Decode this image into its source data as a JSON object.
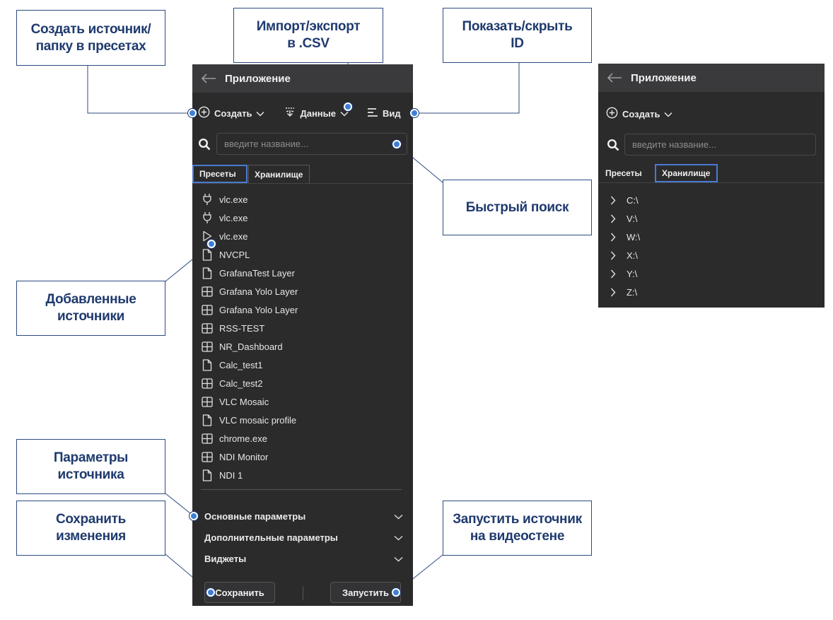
{
  "callouts": {
    "create": "Создать источник/\nпапку в пресетах",
    "import": "Импорт/экспорт\nв .CSV",
    "toggle_id": "Показать/скрыть\nID",
    "quick_search": "Быстрый поиск",
    "added_sources": "Добавленные\nисточники",
    "source_params": "Параметры\nисточника",
    "save_changes": "Сохранить\nизменения",
    "launch": "Запустить источник\nна видеостене"
  },
  "left_panel": {
    "title": "Приложение",
    "toolbar": {
      "create": "Создать",
      "data": "Данные",
      "view": "Вид"
    },
    "search_placeholder": "введите название...",
    "tabs": [
      {
        "label": "Пресеты",
        "active": true
      },
      {
        "label": "Хранилище",
        "active": false
      }
    ],
    "items": [
      {
        "label": "vlc.exe",
        "icon": "plug-icon"
      },
      {
        "label": "vlc.exe",
        "icon": "plug-icon"
      },
      {
        "label": "vlc.exe",
        "icon": "play-icon"
      },
      {
        "label": "NVCPL",
        "icon": "file-icon"
      },
      {
        "label": "GrafanaTest Layer",
        "icon": "file-icon"
      },
      {
        "label": "Grafana Yolo Layer",
        "icon": "grid-icon"
      },
      {
        "label": "Grafana Yolo Layer",
        "icon": "grid-icon"
      },
      {
        "label": "RSS-TEST",
        "icon": "grid-icon"
      },
      {
        "label": "NR_Dashboard",
        "icon": "grid-icon"
      },
      {
        "label": "Calc_test1",
        "icon": "file-icon"
      },
      {
        "label": "Calc_test2",
        "icon": "grid-icon"
      },
      {
        "label": "VLC Mosaic",
        "icon": "grid-icon"
      },
      {
        "label": "VLC mosaic profile",
        "icon": "file-icon"
      },
      {
        "label": "chrome.exe",
        "icon": "grid-icon"
      },
      {
        "label": "NDI Monitor",
        "icon": "grid-icon"
      },
      {
        "label": "NDI 1",
        "icon": "file-icon"
      }
    ],
    "sections": {
      "basic": "Основные параметры",
      "advanced": "Дополнительные параметры",
      "widgets": "Виджеты"
    },
    "buttons": {
      "save": "Сохранить",
      "launch": "Запустить"
    }
  },
  "right_panel": {
    "title": "Приложение",
    "toolbar": {
      "create": "Создать"
    },
    "search_placeholder": "введите название...",
    "tabs": [
      {
        "label": "Пресеты",
        "active": false
      },
      {
        "label": "Хранилище",
        "active": true
      }
    ],
    "drives": [
      {
        "label": "C:\\"
      },
      {
        "label": "V:\\"
      },
      {
        "label": "W:\\"
      },
      {
        "label": "X:\\"
      },
      {
        "label": "Y:\\"
      },
      {
        "label": "Z:\\"
      }
    ]
  },
  "colors": {
    "panel_bg": "#2b2b2c",
    "header_bg": "#3a3a3c",
    "accent": "#3d7fd6",
    "callout_text": "#1f3a6e"
  }
}
